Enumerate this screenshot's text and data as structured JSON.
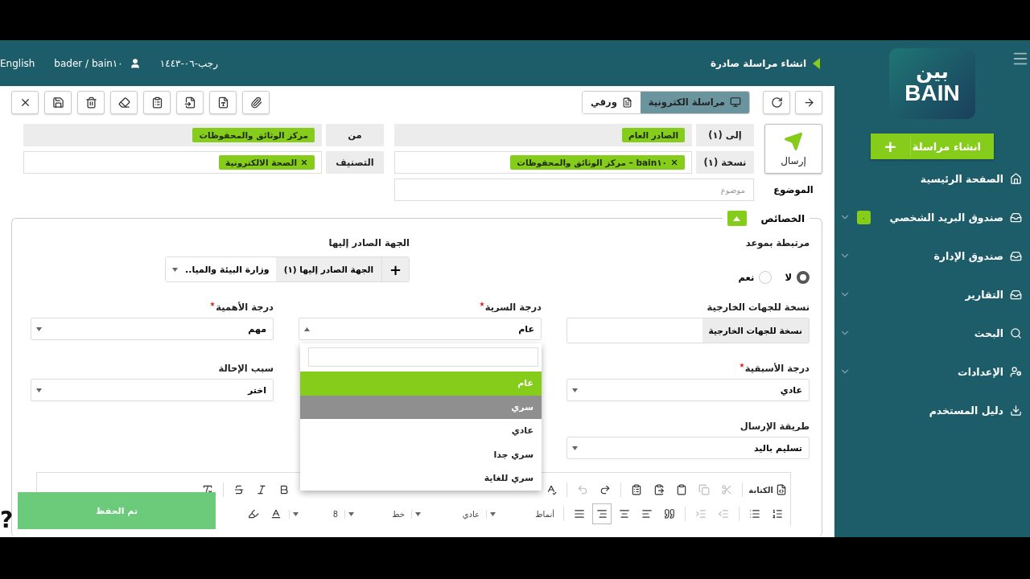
{
  "header": {
    "title": "انشاء مراسلة صادرة",
    "date": "رجب-٠٦-١٤٤٣",
    "user": "bader / bain١٠",
    "language": "English"
  },
  "mode_tabs": [
    {
      "label": "مراسلة الكترونية",
      "selected": true
    },
    {
      "label": "ورقي",
      "selected": false
    }
  ],
  "send_button": "إرسال",
  "recipient_fields": [
    {
      "label": "إلى (١)",
      "readonly": true,
      "tags": [
        {
          "text": "الصادر العام",
          "removable": false
        }
      ]
    },
    {
      "label": "نسخة (١)",
      "readonly": false,
      "tags": [
        {
          "text": "bain١٠ – مركز الوثائق والمحفوظات",
          "removable": true
        }
      ]
    }
  ],
  "subject": {
    "label": "الموضوع",
    "placeholder": "موضوع"
  },
  "sender_fields": [
    {
      "label": "من",
      "readonly": true,
      "tags": [
        {
          "text": "مركز الوثائق والمحفوظات",
          "removable": false
        }
      ]
    },
    {
      "label": "التصنيف",
      "readonly": false,
      "tags": [
        {
          "text": "الصحة الالكترونية",
          "removable": true
        }
      ]
    }
  ],
  "properties": {
    "title": "الخصائص",
    "expanded": true,
    "appointment": {
      "label": "مرتبطة بموعد",
      "options": [
        {
          "label": "لا",
          "selected": true
        },
        {
          "label": "نعم",
          "selected": false
        }
      ]
    },
    "recipient_entity": {
      "label": "الجهة الصادر إليها",
      "add": "+",
      "addon": "الجهة الصادر إليها (١)",
      "value": "وزارة البيئة والميا.."
    },
    "external_copy": {
      "label": "نسخة للجهات الخارجية",
      "button": "نسخة للجهات الخارجية"
    },
    "confidentiality": {
      "label": "درجة السرية",
      "required": true,
      "value": "عام",
      "open": true,
      "options": [
        {
          "label": "عام",
          "selected": true,
          "hovered": false
        },
        {
          "label": "سري",
          "selected": false,
          "hovered": true
        },
        {
          "label": "عادي",
          "selected": false,
          "hovered": false
        },
        {
          "label": "سري جدا",
          "selected": false,
          "hovered": false
        },
        {
          "label": "سري للغاية",
          "selected": false,
          "hovered": false
        }
      ]
    },
    "importance": {
      "label": "درجة الأهمية",
      "required": true,
      "value": "مهم"
    },
    "priority": {
      "label": "درجة الأسبقية",
      "required": true,
      "value": "عادي"
    },
    "referral_reason": {
      "label": "سبب الإحالة",
      "required": false,
      "value": "اختر"
    },
    "delivery": {
      "label": "طريقة الإرسال",
      "required": false,
      "value": "تسليم باليد"
    }
  },
  "editor": {
    "source_label": "الكتابة",
    "styles": "أنماط",
    "format": "عادي",
    "font": "خط",
    "size": "8",
    "alignments": [
      {
        "kind": "left",
        "selected": false
      },
      {
        "kind": "center",
        "selected": false
      },
      {
        "kind": "right",
        "selected": true
      },
      {
        "kind": "justify",
        "selected": false
      }
    ]
  },
  "toast": "تم الحفظ",
  "help": "?",
  "sidebar": {
    "logo_arabic": "بين",
    "logo_latin": "BAIN",
    "new_button": "انشاء مراسلة",
    "new_icon": "+",
    "items": [
      {
        "kind": "home",
        "label": "الصفحة الرئيسية",
        "expandable": false
      },
      {
        "kind": "inbox",
        "label": "صندوق البريد الشخصي",
        "expandable": true,
        "badge": "٠"
      },
      {
        "kind": "inbox",
        "label": "صندوق الإدارة",
        "expandable": true
      },
      {
        "kind": "inbox",
        "label": "التقارير",
        "expandable": true
      },
      {
        "kind": "search",
        "label": "البحث",
        "expandable": true
      },
      {
        "kind": "settings",
        "label": "الإعدادات",
        "expandable": true
      },
      {
        "kind": "download",
        "label": "دليل المستخدم",
        "expandable": false
      }
    ]
  }
}
